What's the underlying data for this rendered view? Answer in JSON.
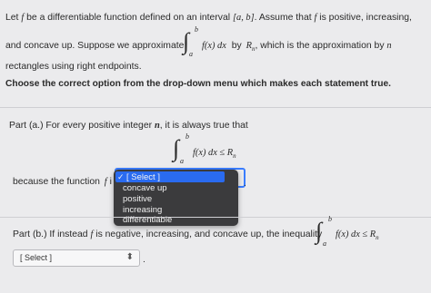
{
  "intro": {
    "line1_a": "Let ",
    "line1_f": "f",
    "line1_b": " be a differentiable function defined on an interval ",
    "line1_interval": "[a, b]",
    "line1_c": ". Assume that ",
    "line1_f2": "f",
    "line1_d": " is positive, increasing,",
    "line2_a": "and concave up. Suppose we approximate",
    "integral_upper": "b",
    "integral_lower": "a",
    "integrand": "f(x) dx",
    "line2_b": "by",
    "rn": "R",
    "rn_sub": "n",
    "line2_c": ", which is the approximation by",
    "n_var": "n",
    "line3": "rectangles using right endpoints."
  },
  "instruction": "Choose the correct option from the drop-down menu which makes each statement true.",
  "part_a": {
    "label": "Part (a.)",
    "text_a": "For every positive integer",
    "n_var": "n",
    "text_b": ", it is always true that",
    "integral_upper": "b",
    "integral_lower": "a",
    "inequality": "f(x) dx ≤ R",
    "rn_sub": "n",
    "because_text": "because the function",
    "f_var": "f",
    "f_suffix": "i",
    "trailing": "."
  },
  "dropdown": {
    "selected_label": "[ Select ]",
    "check_icon": "✓",
    "options": [
      "concave up",
      "positive",
      "increasing",
      "differentiable"
    ]
  },
  "part_b": {
    "label": "Part (b.)",
    "text_a": "If instead",
    "f_var": "f",
    "text_b": "is negative, increasing, and concave up, the inequality",
    "integral_upper": "b",
    "integral_lower": "a",
    "inequality": "f(x) dx ≤ R",
    "rn_sub": "n",
    "select_label": "[ Select ]",
    "select_arrow": "⬍",
    "trailing": "."
  },
  "colors": {
    "background": "#ebebed",
    "dropdown_bg": "#3b3b3d",
    "dropdown_highlight": "#2a6bf0",
    "focus_ring": "#3a7dff"
  }
}
